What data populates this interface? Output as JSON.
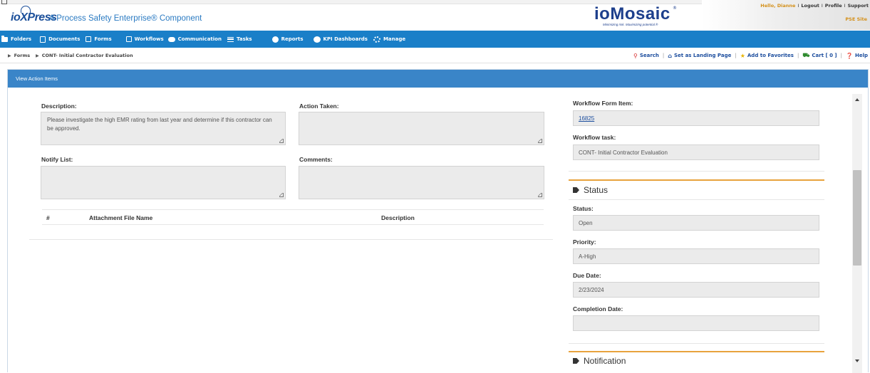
{
  "header": {
    "logo_text": "ioXPress",
    "tagline": "A Process Safety Enterprise® Component",
    "brand_name": "ioMosaic",
    "brand_reg": "®",
    "brand_slogan": "Minimizing risk. Maximizing potential.®",
    "greeting": "Hello, Dianne",
    "links": [
      "Logout",
      "Profile",
      "Support"
    ],
    "site_label": "PSE Site",
    "accent_color": "#d4901a"
  },
  "navbar": {
    "color": "#1a7fc8",
    "items": [
      {
        "label": "Folders",
        "icon": "folder-icon"
      },
      {
        "label": "Documents",
        "icon": "documents-icon"
      },
      {
        "label": "Forms",
        "icon": "edit-icon"
      },
      {
        "label": "Workflows",
        "icon": "check-square-icon"
      },
      {
        "label": "Communication",
        "icon": "chat-icon"
      },
      {
        "label": "Tasks",
        "icon": "list-icon"
      },
      {
        "label": "Reports",
        "icon": "pie-chart-icon"
      },
      {
        "label": "KPI Dashboards",
        "icon": "dashboard-icon"
      },
      {
        "label": "Manage",
        "icon": "gears-icon"
      }
    ]
  },
  "breadcrumb": {
    "items": [
      "Forms",
      "CONT- Initial Contractor Evaluation"
    ]
  },
  "toolbar": {
    "search": "Search",
    "landing": "Set as Landing Page",
    "favorites": "Add to Favorites",
    "cart": "Cart [ 0 ]",
    "help": "Help"
  },
  "panel": {
    "title": "View Action Items"
  },
  "form": {
    "description_label": "Description:",
    "description_value": "Please investigate the high EMR rating from last year and determine if this contractor can be approved.",
    "action_taken_label": "Action Taken:",
    "action_taken_value": "",
    "notify_label": "Notify List:",
    "notify_value": "",
    "comments_label": "Comments:",
    "comments_value": ""
  },
  "attachments": {
    "columns": [
      "#",
      "Attachment File Name",
      "Description"
    ],
    "rows": []
  },
  "right": {
    "workflow_form_item_label": "Workflow Form Item:",
    "workflow_form_item_value": "16825",
    "workflow_task_label": "Workflow task:",
    "workflow_task_value": "CONT- Initial Contractor Evaluation",
    "status_section": "Status",
    "status_label": "Status:",
    "status_value": "Open",
    "priority_label": "Priority:",
    "priority_value": "A-High",
    "due_date_label": "Due Date:",
    "due_date_value": "2/23/2024",
    "completion_date_label": "Completion Date:",
    "completion_date_value": "",
    "notification_section": "Notification"
  }
}
